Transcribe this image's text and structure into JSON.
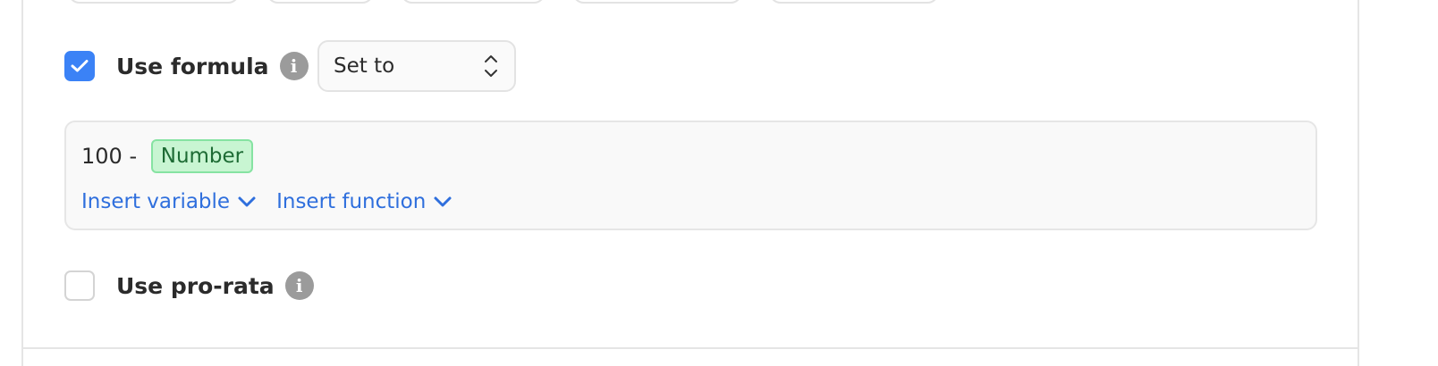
{
  "formula_option": {
    "label": "Use formula",
    "checked": true,
    "info_icon": "info-icon",
    "mode_select": {
      "value": "Set to"
    }
  },
  "formula_editor": {
    "expression_prefix": "100 - ",
    "variable_chip": "Number",
    "insert_variable_label": "Insert variable",
    "insert_function_label": "Insert function"
  },
  "prorata_option": {
    "label": "Use pro-rata",
    "checked": false,
    "info_icon": "info-icon"
  },
  "colors": {
    "accent": "#3b82f6",
    "link": "#2f6fdd",
    "chip_bg": "#c8f5d2",
    "chip_text": "#1d6b34"
  }
}
